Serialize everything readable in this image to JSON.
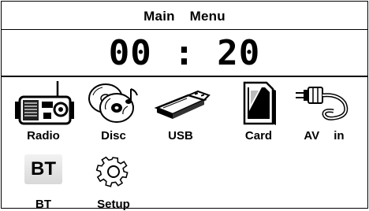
{
  "header": {
    "title": "Main Menu"
  },
  "clock": {
    "time": "00 : 20"
  },
  "menu": {
    "items": [
      {
        "label": "Radio",
        "icon": "radio-icon"
      },
      {
        "label": "Disc",
        "icon": "disc-icon"
      },
      {
        "label": "USB",
        "icon": "usb-icon"
      },
      {
        "label": "Card",
        "icon": "sd-card-icon"
      },
      {
        "label": "AV in",
        "icon": "av-cable-icon"
      },
      {
        "label": "BT",
        "icon": "bluetooth-icon",
        "icon_text": "BT"
      },
      {
        "label": "Setup",
        "icon": "gear-icon"
      }
    ]
  }
}
